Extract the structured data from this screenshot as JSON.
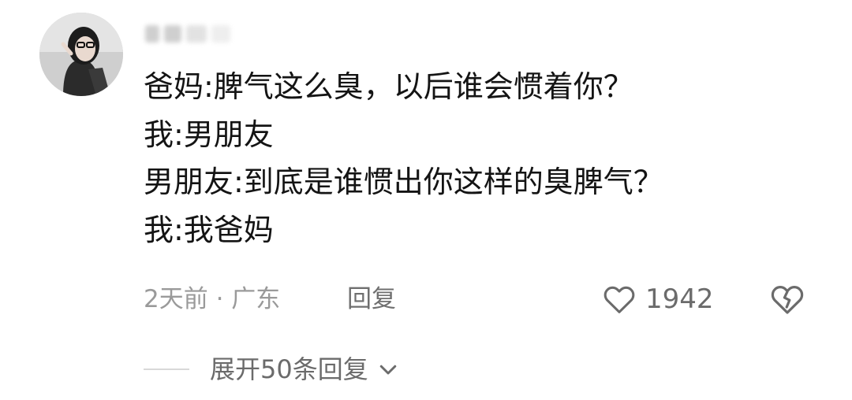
{
  "comment": {
    "lines": [
      "爸妈:脾气这么臭，以后谁会惯着你？",
      "我:男朋友",
      "男朋友:到底是谁惯出你这样的臭脾气？",
      "我:我爸妈"
    ],
    "meta": "2天前 · 广东",
    "reply_label": "回复",
    "like_count": "1942",
    "expand_label": "展开50条回复"
  },
  "icons": {
    "like": "heart-outline-icon",
    "dislike": "broken-heart-icon",
    "expand": "chevron-down-icon"
  },
  "colors": {
    "text": "#141414",
    "meta": "#9a9a9a",
    "secondary": "#6b6b6b"
  }
}
